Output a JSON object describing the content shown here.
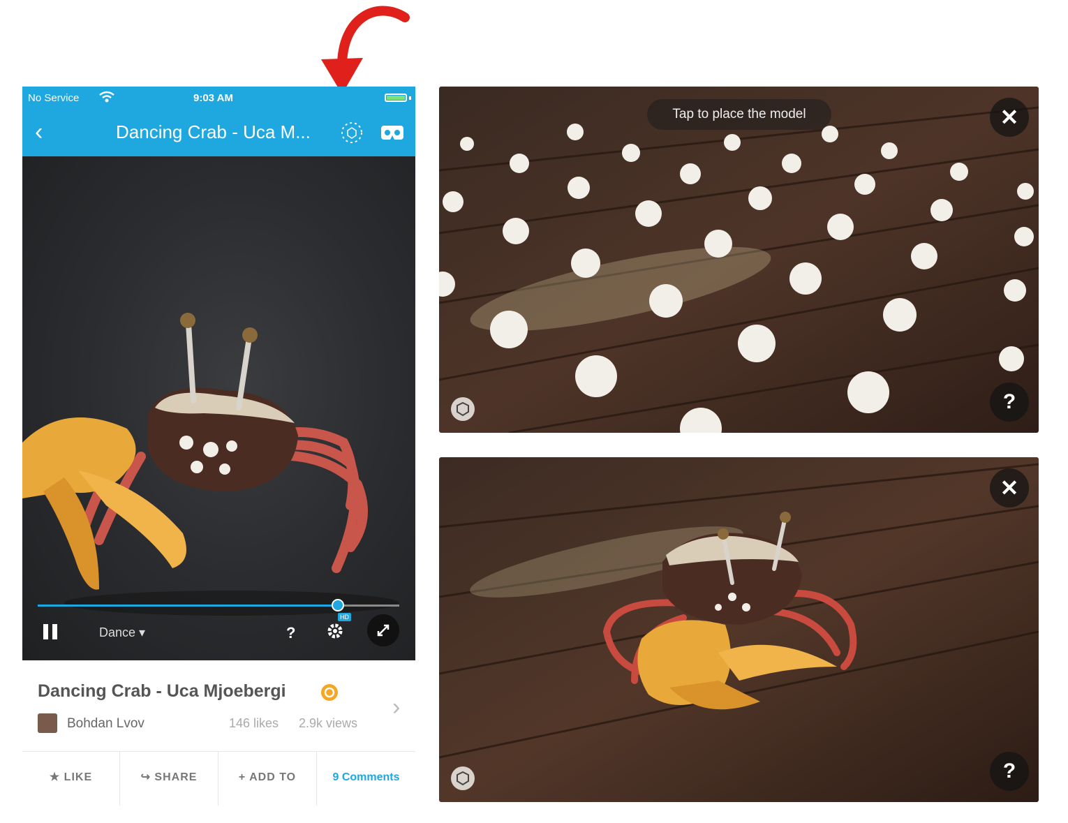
{
  "status_bar": {
    "carrier": "No Service",
    "time": "9:03 AM"
  },
  "nav": {
    "title": "Dancing Crab - Uca M..."
  },
  "viewer": {
    "animation": "Dance",
    "help": "?",
    "hd": "HD",
    "progress": 0.83
  },
  "model": {
    "title": "Dancing Crab - Uca Mjoebergi",
    "author": "Bohdan Lvov",
    "likes": "146 likes",
    "views": "2.9k views"
  },
  "actions": [
    {
      "label": "LIKE",
      "icon": "star-icon"
    },
    {
      "label": "SHARE",
      "icon": "share-icon"
    },
    {
      "label": "ADD TO",
      "icon": "plus-icon"
    },
    {
      "label": "9 Comments",
      "icon": ""
    }
  ],
  "ar_placement": {
    "toast": "Tap to place the model",
    "close": "✕",
    "help": "?"
  },
  "ar_placed": {
    "close": "✕",
    "help": "?"
  },
  "colors": {
    "accent": "#1fa7df",
    "annotation": "#e0201b"
  }
}
